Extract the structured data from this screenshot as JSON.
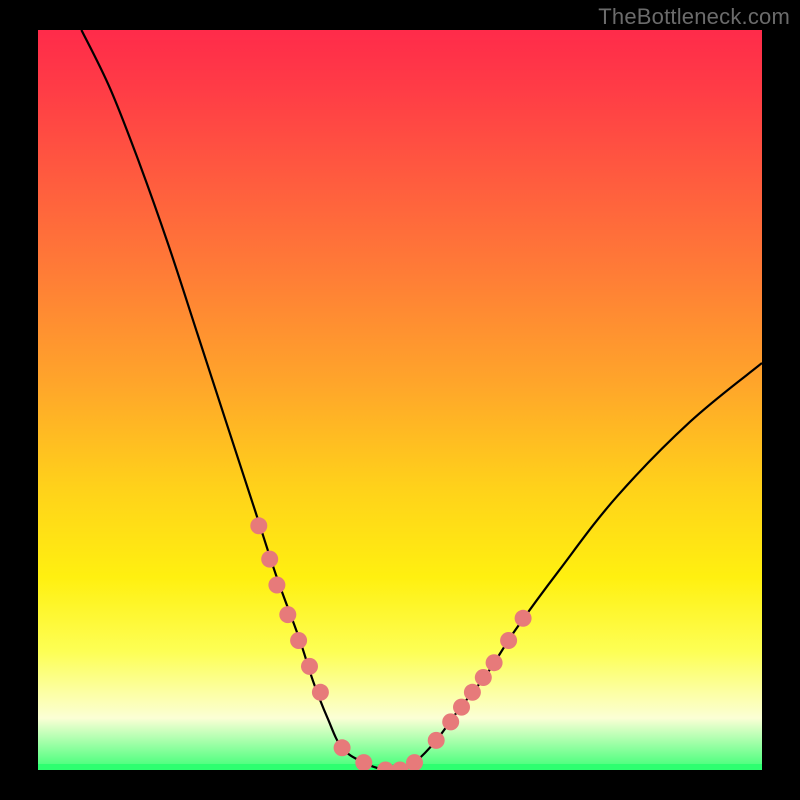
{
  "watermark": "TheBottleneck.com",
  "colors": {
    "frame": "#000000",
    "curve": "#000000",
    "marker": "#e77a7a",
    "gradient_top": "#ff2b4a",
    "gradient_bottom": "#2dff70"
  },
  "chart_data": {
    "type": "line",
    "title": "",
    "xlabel": "",
    "ylabel": "",
    "xlim": [
      0,
      100
    ],
    "ylim": [
      0,
      100
    ],
    "description": "V-shaped bottleneck curve over vertical spectral gradient (red→yellow→green). Minimum (≈0) occurs ~x=42–52. Left arm is steeper than right arm which rises to ~55 at x=100.",
    "series": [
      {
        "name": "bottleneck-curve",
        "x": [
          6,
          10,
          14,
          18,
          22,
          26,
          30,
          33,
          36,
          38,
          40,
          42,
          45,
          48,
          50,
          52,
          55,
          58,
          62,
          66,
          72,
          80,
          90,
          100
        ],
        "values": [
          100,
          92,
          82,
          71,
          59,
          47,
          35,
          26,
          18,
          12,
          7,
          3,
          1,
          0,
          0,
          1,
          4,
          8,
          13,
          19,
          27,
          37,
          47,
          55
        ]
      }
    ],
    "markers": {
      "name": "highlighted-points",
      "x": [
        30.5,
        32,
        33,
        34.5,
        36,
        37.5,
        39,
        42,
        45,
        48,
        50,
        52,
        55,
        57,
        58.5,
        60,
        61.5,
        63,
        65,
        67
      ],
      "values": [
        33,
        28.5,
        25,
        21,
        17.5,
        14,
        10.5,
        3,
        1,
        0,
        0,
        1,
        4,
        6.5,
        8.5,
        10.5,
        12.5,
        14.5,
        17.5,
        20.5
      ]
    }
  }
}
